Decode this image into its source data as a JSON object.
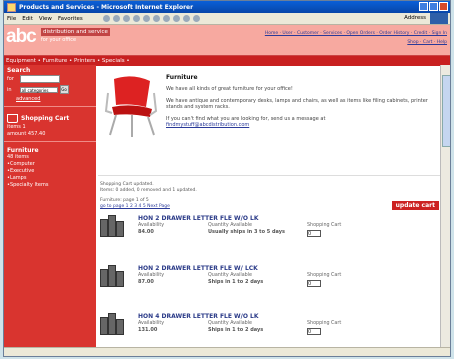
{
  "window": {
    "title": "Products and Services - Microsoft Internet Explorer"
  },
  "menu": [
    "File",
    "Edit",
    "View",
    "Favorites"
  ],
  "address_label": "Address",
  "header": {
    "logo": "abc",
    "tagline": "distribution and service",
    "tagline2": "for your office",
    "links_row1": "Home · User · Customer · Services · Open Orders · Order History · Credit · Sign In",
    "links_row2": "Shop · Cart · Help"
  },
  "nav": "Equipment • Furniture • Printers • Specials •",
  "sidebar": {
    "search_head": "Search",
    "for_label": "for",
    "in_label": "in",
    "select_value": "all categories",
    "go_label": "Go",
    "advanced_link": "advanced",
    "cart_head": "Shopping Cart",
    "items_line": "items   1",
    "amount_line": "amount  457.40",
    "furniture_head": "Furniture",
    "furniture_count": "48 items",
    "categories": [
      "•Computer",
      "•Executive",
      "•Lamps",
      "•Specialty Items"
    ]
  },
  "main": {
    "title": "Furniture",
    "p1": "We have all kinds of great furniture for your office!",
    "p2": "We have antique and contemporary desks, lamps and chairs, as well as items like filing cabinets, printer stands and system racks.",
    "p3": "If you can't find what you are looking for, send us a message at",
    "email": "findmystuff@abcdistribution.com",
    "status1": "Shopping Cart updated.",
    "status2": "Items: 0 added, 0 removed and 1 updated.",
    "pages1": "Furniture: page 1 of 5",
    "pages2": "go to page 1 2 3 4 5 Next Page",
    "update_button": "update cart",
    "col_availability": "Availability",
    "col_quantity": "Quantity Available",
    "col_cart": "Shopping Cart",
    "items": [
      {
        "name": "HON 2 DRAWER LETTER FLE W/O LK",
        "price": "84.00",
        "availability": "Usually ships in 3 to 5 days",
        "qty": "0"
      },
      {
        "name": "HON 2 DRAWER LETTER FLE W/ LCK",
        "price": "87.00",
        "availability": "Ships in 1 to 2 days",
        "qty": "0"
      },
      {
        "name": "HON 4 DRAWER LETTER FLE W/O LK",
        "price": "131.00",
        "availability": "Ships in 1 to 2 days",
        "qty": "0"
      }
    ]
  }
}
